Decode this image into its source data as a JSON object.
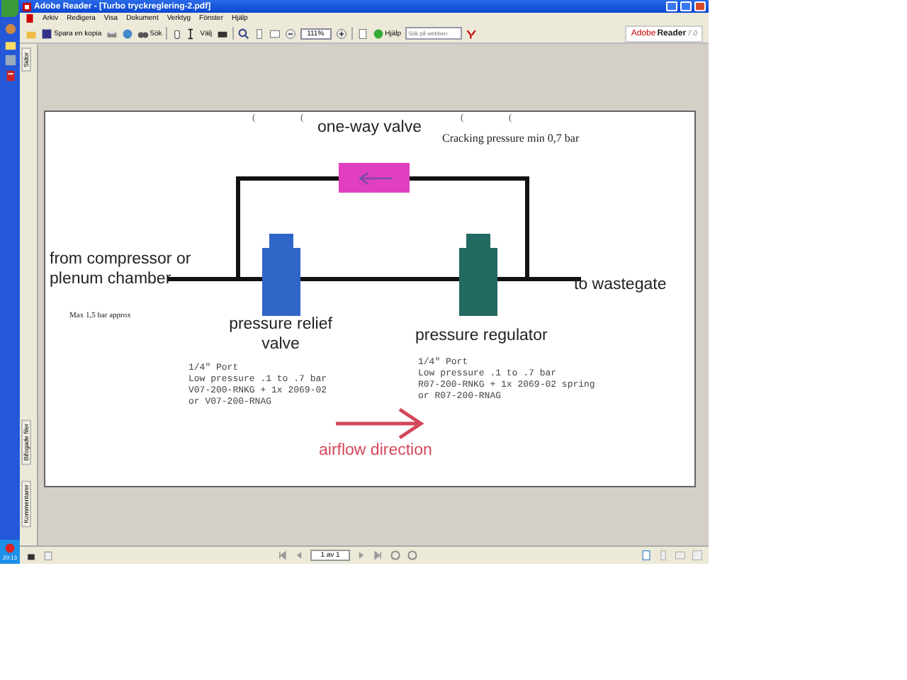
{
  "taskbar": {
    "clock": "20:13"
  },
  "window": {
    "title": "Adobe Reader - [Turbo tryckreglering-2.pdf]",
    "menu": [
      "Arkiv",
      "Redigera",
      "Visa",
      "Dokument",
      "Verktyg",
      "Fönster",
      "Hjälp"
    ],
    "toolbar": {
      "save_copy": "Spara en kopia",
      "search": "Sök",
      "select": "Välj",
      "zoom": "111%",
      "help": "Hjälp",
      "web_search": {
        "placeholder": "Sök på webben"
      }
    },
    "brand": {
      "company": "Adobe",
      "product": "Reader",
      "version": "7.0"
    }
  },
  "nav_tabs": [
    {
      "label": "Sidor"
    },
    {
      "label": "Bifogade filer"
    },
    {
      "label": "Kommentarer"
    }
  ],
  "diagram": {
    "stray_marks": [
      "(",
      "(",
      "(",
      "("
    ],
    "valve_label": "one-way valve",
    "cracking_note": "Cracking pressure min 0,7 bar",
    "inlet_label": [
      "from compressor or",
      "plenum chamber"
    ],
    "outlet_label": "to wastegate",
    "max_note": "Max 1,5 bar approx",
    "relief": {
      "name": [
        "pressure relief",
        "valve"
      ],
      "notes": [
        "1/4\" Port",
        "Low pressure .1 to .7 bar",
        "V07-200-RNKG + 1x 2069-02",
        "or V07-200-RNAG"
      ]
    },
    "regulator": {
      "name": [
        "pressure regulator"
      ],
      "notes": [
        "1/4\" Port",
        "Low pressure .1 to .7 bar",
        "R07-200-RNKG + 1x 2069-02 spring",
        "or R07-200-RNAG"
      ]
    },
    "flow_label": "airflow direction"
  },
  "status_bar": {
    "page": "1 av 1"
  }
}
